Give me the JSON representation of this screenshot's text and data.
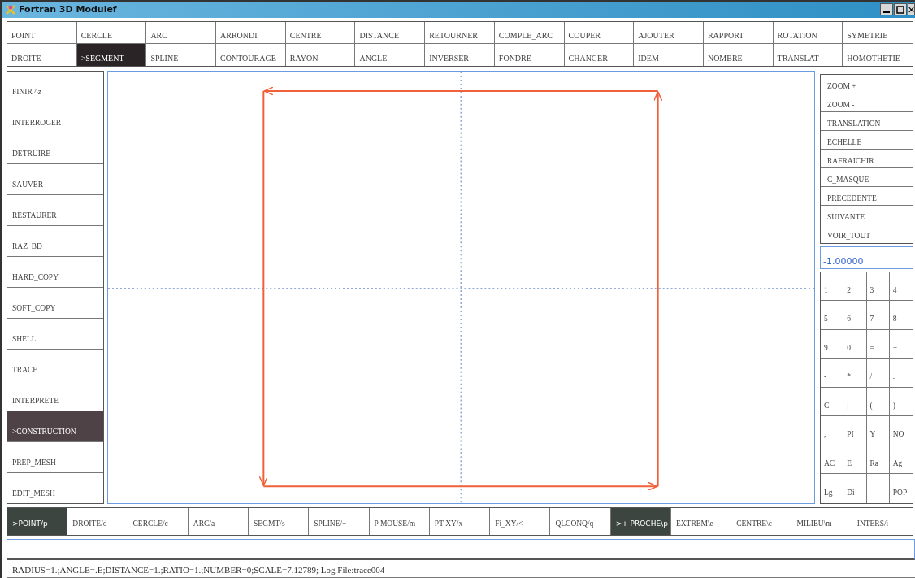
{
  "window": {
    "title": "Fortran 3D Modulef"
  },
  "top_menu": [
    [
      {
        "label": "POINT",
        "selected": false
      },
      {
        "label": "CERCLE",
        "selected": false
      },
      {
        "label": "ARC",
        "selected": false
      },
      {
        "label": "ARRONDI",
        "selected": false
      },
      {
        "label": "CENTRE",
        "selected": false
      },
      {
        "label": "DISTANCE",
        "selected": false
      },
      {
        "label": "RETOURNER",
        "selected": false
      },
      {
        "label": "COMPLE_ARC",
        "selected": false
      },
      {
        "label": "COUPER",
        "selected": false
      },
      {
        "label": "AJOUTER",
        "selected": false
      },
      {
        "label": "RAPPORT",
        "selected": false
      },
      {
        "label": "ROTATION",
        "selected": false
      },
      {
        "label": "SYMETRIE",
        "selected": false
      }
    ],
    [
      {
        "label": "DROITE",
        "selected": false
      },
      {
        "label": ">SEGMENT",
        "selected": true
      },
      {
        "label": "SPLINE",
        "selected": false
      },
      {
        "label": "CONTOURAGE",
        "selected": false
      },
      {
        "label": "RAYON",
        "selected": false
      },
      {
        "label": "ANGLE",
        "selected": false
      },
      {
        "label": "INVERSER",
        "selected": false
      },
      {
        "label": "FONDRE",
        "selected": false
      },
      {
        "label": "CHANGER",
        "selected": false
      },
      {
        "label": "IDEM",
        "selected": false
      },
      {
        "label": "NOMBRE",
        "selected": false
      },
      {
        "label": "TRANSLAT",
        "selected": false
      },
      {
        "label": "HOMOTHETIE",
        "selected": false
      }
    ]
  ],
  "left_menu": [
    {
      "label": "FINIR ^z",
      "selected": false
    },
    {
      "label": "INTERROGER",
      "selected": false
    },
    {
      "label": "DETRUIRE",
      "selected": false
    },
    {
      "label": "SAUVER",
      "selected": false
    },
    {
      "label": "RESTAURER",
      "selected": false
    },
    {
      "label": "RAZ_BD",
      "selected": false
    },
    {
      "label": "HARD_COPY",
      "selected": false
    },
    {
      "label": "SOFT_COPY",
      "selected": false
    },
    {
      "label": "SHELL",
      "selected": false
    },
    {
      "label": "TRACE",
      "selected": false
    },
    {
      "label": "INTERPRETE",
      "selected": false
    },
    {
      "label": ">CONSTRUCTION",
      "selected": true
    },
    {
      "label": "PREP_MESH",
      "selected": false
    },
    {
      "label": "EDIT_MESH",
      "selected": false
    }
  ],
  "view_menu": [
    "ZOOM +",
    "ZOOM -",
    "TRANSLATION",
    "ECHELLE",
    "RAFRAICHIR",
    "C_MASQUE",
    "PRECEDENTE",
    "SUIVANTE",
    "VOIR_TOUT"
  ],
  "value_field": {
    "value": "-1.00000"
  },
  "keypad": [
    [
      {
        "kind": "key",
        "label": "1"
      },
      {
        "kind": "key",
        "label": "2"
      },
      {
        "kind": "key",
        "label": "3"
      },
      {
        "kind": "key",
        "label": "4"
      }
    ],
    [
      {
        "kind": "key",
        "label": "5"
      },
      {
        "kind": "key",
        "label": "6"
      },
      {
        "kind": "key",
        "label": "7"
      },
      {
        "kind": "key",
        "label": "8"
      }
    ],
    [
      {
        "kind": "key",
        "label": "9"
      },
      {
        "kind": "key",
        "label": "0"
      },
      {
        "kind": "key",
        "label": "="
      },
      {
        "kind": "key",
        "label": "+"
      }
    ],
    [
      {
        "kind": "key",
        "label": "-"
      },
      {
        "kind": "key",
        "label": "*"
      },
      {
        "kind": "key",
        "label": "/"
      },
      {
        "kind": "key",
        "label": "."
      }
    ],
    [
      {
        "kind": "key",
        "label": "C"
      },
      {
        "kind": "key",
        "label": "|"
      },
      {
        "kind": "key",
        "label": "("
      },
      {
        "kind": "key",
        "label": ")"
      }
    ],
    [
      {
        "kind": "key",
        "label": ","
      },
      {
        "kind": "key",
        "label": "PI"
      },
      {
        "kind": "key",
        "label": "Y"
      },
      {
        "kind": "key",
        "label": "NO"
      }
    ],
    [
      {
        "kind": "key",
        "label": "AC"
      },
      {
        "kind": "key",
        "label": "E"
      },
      {
        "kind": "key",
        "label": "Ra"
      },
      {
        "kind": "key",
        "label": "Ag"
      }
    ],
    [
      {
        "kind": "key",
        "label": "Lg"
      },
      {
        "kind": "key",
        "label": "Di"
      },
      {
        "kind": "blank"
      },
      {
        "kind": "key",
        "label": "POP"
      }
    ]
  ],
  "bottom_menu": [
    {
      "label": ">POINT/p",
      "selected": true
    },
    {
      "label": "DROITE/d",
      "selected": false
    },
    {
      "label": "CERCLE/c",
      "selected": false
    },
    {
      "label": "ARC/a",
      "selected": false
    },
    {
      "label": "SEGMT/s",
      "selected": false
    },
    {
      "label": "SPLINE/~",
      "selected": false
    },
    {
      "label": "P MOUSE/m",
      "selected": false
    },
    {
      "label": "PT XY/x",
      "selected": false
    },
    {
      "label": "Fi_XY/<",
      "selected": false
    },
    {
      "label": "QLCONQ/q",
      "selected": false
    },
    {
      "label": ">+ PROCHE\\p",
      "selected": true
    },
    {
      "label": "EXTREM\\e",
      "selected": false
    },
    {
      "label": "CENTRE\\c",
      "selected": false
    },
    {
      "label": "MILIEU\\m",
      "selected": false
    },
    {
      "label": "INTERS/i",
      "selected": false
    }
  ],
  "status_bar": {
    "text": "RADIUS=1.;ANGLE=.E;DISTANCE=1.;RATIO=1.;NUMBER=0;SCALE=7.12789; Log File:trace004"
  }
}
